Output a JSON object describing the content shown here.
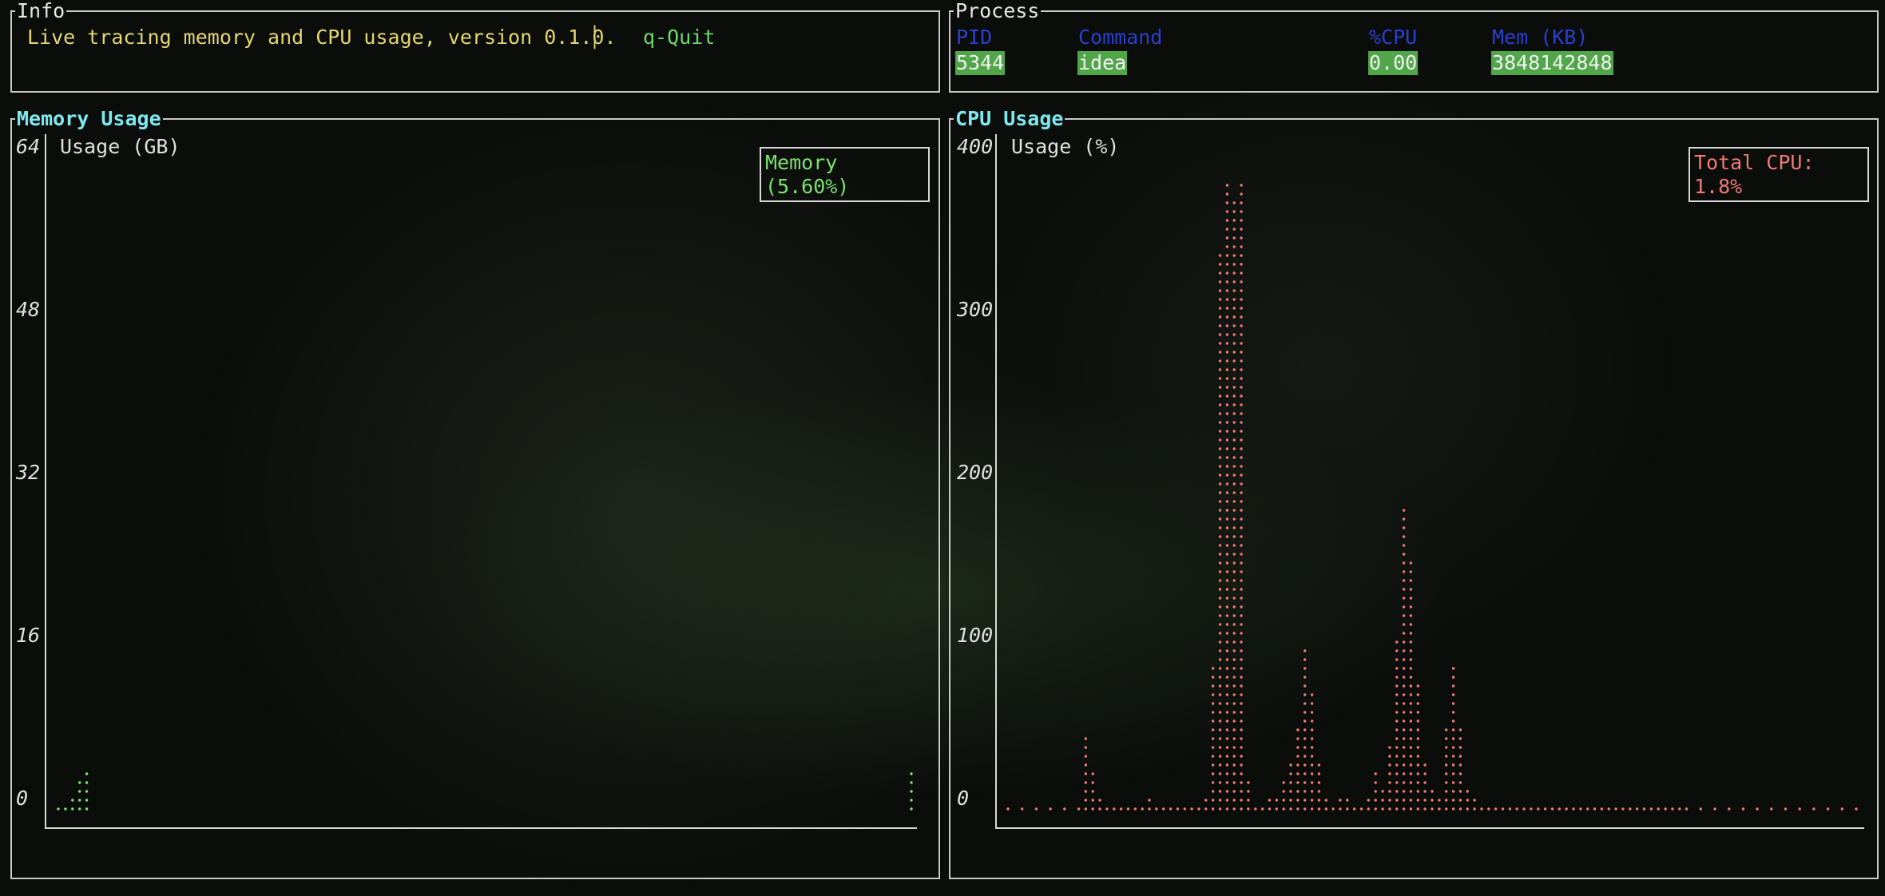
{
  "info": {
    "title": "Info",
    "description": "Live tracing memory and CPU usage, version 0.1.0.",
    "separator": "│",
    "quit": "q-Quit"
  },
  "process": {
    "title": "Process",
    "headers": [
      "PID",
      "Command",
      "%CPU",
      "Mem (KB)"
    ],
    "row": {
      "pid": "5344",
      "command": "idea",
      "cpu": "0.00",
      "mem": "3848142848"
    }
  },
  "memory": {
    "title": "Memory Usage",
    "ylabel": "Usage (GB)",
    "yticks": [
      "64",
      "48",
      "32",
      "16",
      "0"
    ],
    "legend": "Memory (5.60%)",
    "color": "#7be36b"
  },
  "cpu": {
    "title": "CPU Usage",
    "ylabel": "Usage (%)",
    "yticks": [
      "400",
      "300",
      "200",
      "100",
      "0"
    ],
    "legend": "Total CPU: 1.8%",
    "color": "#f07b72"
  },
  "chart_data": [
    {
      "type": "scatter",
      "title": "Memory Usage",
      "ylabel": "Usage (GB)",
      "ylim": [
        0,
        64
      ],
      "legend": "Memory (5.60%)",
      "series": [
        {
          "name": "Memory (5.60%)",
          "x": [
            0,
            1,
            2,
            3,
            4,
            120
          ],
          "y": [
            0.1,
            0.1,
            1.5,
            3.2,
            3.6,
            3.6
          ]
        }
      ]
    },
    {
      "type": "scatter",
      "title": "CPU Usage",
      "ylabel": "Usage (%)",
      "ylim": [
        0,
        400
      ],
      "legend": "Total CPU: 1.8%",
      "series": [
        {
          "name": "Total CPU: 1.8%",
          "x": [
            0,
            4,
            8,
            12,
            16,
            20,
            22,
            24,
            26,
            28,
            30,
            32,
            34,
            36,
            38,
            40,
            42,
            44,
            46,
            48,
            50,
            52,
            54,
            56,
            58,
            60,
            62,
            64,
            66,
            68,
            70,
            72,
            74,
            76,
            78,
            80,
            82,
            84,
            86,
            88,
            90,
            92,
            94,
            96,
            98,
            100,
            102,
            104,
            106,
            108,
            110,
            112,
            114,
            116,
            118,
            120,
            122,
            124,
            126,
            128,
            130,
            132,
            134,
            136,
            138,
            140,
            142,
            144,
            146,
            148,
            150,
            152,
            154,
            156,
            158,
            160,
            162,
            164,
            166,
            168,
            170,
            172,
            174,
            176,
            178,
            180,
            182,
            184,
            186,
            188,
            190,
            192,
            196,
            200,
            204,
            208,
            212,
            216,
            220,
            224,
            228,
            232,
            236,
            240
          ],
          "y": [
            0,
            2,
            3,
            4,
            5,
            4,
            45,
            25,
            8,
            5,
            3,
            4,
            5,
            4,
            3,
            6,
            4,
            5,
            3,
            4,
            5,
            4,
            3,
            6,
            90,
            350,
            395,
            385,
            395,
            20,
            5,
            4,
            6,
            10,
            20,
            30,
            50,
            100,
            75,
            30,
            8,
            5,
            6,
            8,
            4,
            5,
            10,
            25,
            15,
            40,
            110,
            190,
            160,
            80,
            30,
            15,
            10,
            50,
            90,
            55,
            15,
            10,
            5,
            4,
            3,
            2,
            2,
            3,
            2,
            1,
            1,
            1,
            1,
            1,
            1,
            1,
            1,
            1,
            1,
            1,
            1,
            1,
            1,
            1,
            1,
            1,
            1,
            1,
            1,
            1,
            1,
            1,
            1,
            1,
            1,
            1,
            1,
            1,
            1,
            1,
            1,
            1,
            1,
            1
          ]
        }
      ]
    }
  ]
}
